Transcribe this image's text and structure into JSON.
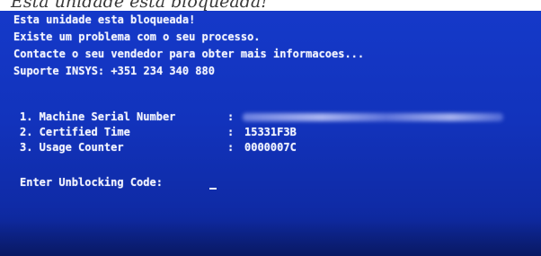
{
  "caption": "Esta unidade esta bloqueada!",
  "terminal": {
    "message_lines": [
      "Esta unidade esta bloqueada!",
      "Existe um problema com o seu processo.",
      "Contacte o seu vendedor para obter mais informacoes...",
      "Suporte INSYS: +351 234 340 880"
    ],
    "fields": [
      {
        "label": "1. Machine Serial Number",
        "value": ""
      },
      {
        "label": "2. Certified Time",
        "value": "15331F3B"
      },
      {
        "label": "3. Usage Counter",
        "value": "0000007C"
      }
    ],
    "separator": ":",
    "prompt": "Enter Unblocking Code:"
  },
  "colors": {
    "screen_background": "#1233bc",
    "text": "#f2f4ff"
  }
}
